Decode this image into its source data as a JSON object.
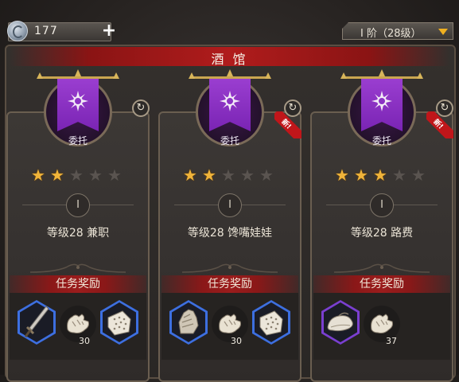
{
  "currency": {
    "icon": "silver-coin-icon",
    "amount": "177",
    "add_label": "+"
  },
  "tier": {
    "label": "I 阶（28级）"
  },
  "panel": {
    "title": "酒 馆"
  },
  "cards": [
    {
      "emblem_label": "委托",
      "stars_filled": 2,
      "stars_total": 5,
      "level_numeral": "I",
      "quest_name": "等级28 兼职",
      "is_new": false,
      "new_tag": "",
      "reward_header": "任务奖励",
      "rewards": [
        {
          "icon": "sword-icon",
          "frame": "blue-hex",
          "count": ""
        },
        {
          "icon": "claw-material-icon",
          "frame": "circle",
          "count": "30"
        },
        {
          "icon": "stone-block-icon",
          "frame": "blue-hex",
          "count": ""
        }
      ]
    },
    {
      "emblem_label": "委托",
      "stars_filled": 2,
      "stars_total": 5,
      "level_numeral": "I",
      "quest_name": "等级28 馋嘴娃娃",
      "is_new": true,
      "new_tag": "新!",
      "reward_header": "任务奖励",
      "rewards": [
        {
          "icon": "gauntlet-icon",
          "frame": "blue-hex",
          "count": ""
        },
        {
          "icon": "claw-material-icon",
          "frame": "circle",
          "count": "30"
        },
        {
          "icon": "stone-block-icon",
          "frame": "blue-hex",
          "count": ""
        }
      ]
    },
    {
      "emblem_label": "委托",
      "stars_filled": 3,
      "stars_total": 5,
      "level_numeral": "I",
      "quest_name": "等级28 路费",
      "is_new": true,
      "new_tag": "新!",
      "reward_header": "任务奖励",
      "rewards": [
        {
          "icon": "hat-icon",
          "frame": "purple-hex",
          "count": ""
        },
        {
          "icon": "claw-material-icon",
          "frame": "circle",
          "count": "37"
        }
      ]
    }
  ],
  "colors": {
    "accent_red": "#b01c1c",
    "star_gold": "#f0b43a",
    "banner_purple": "#8a30c4"
  }
}
